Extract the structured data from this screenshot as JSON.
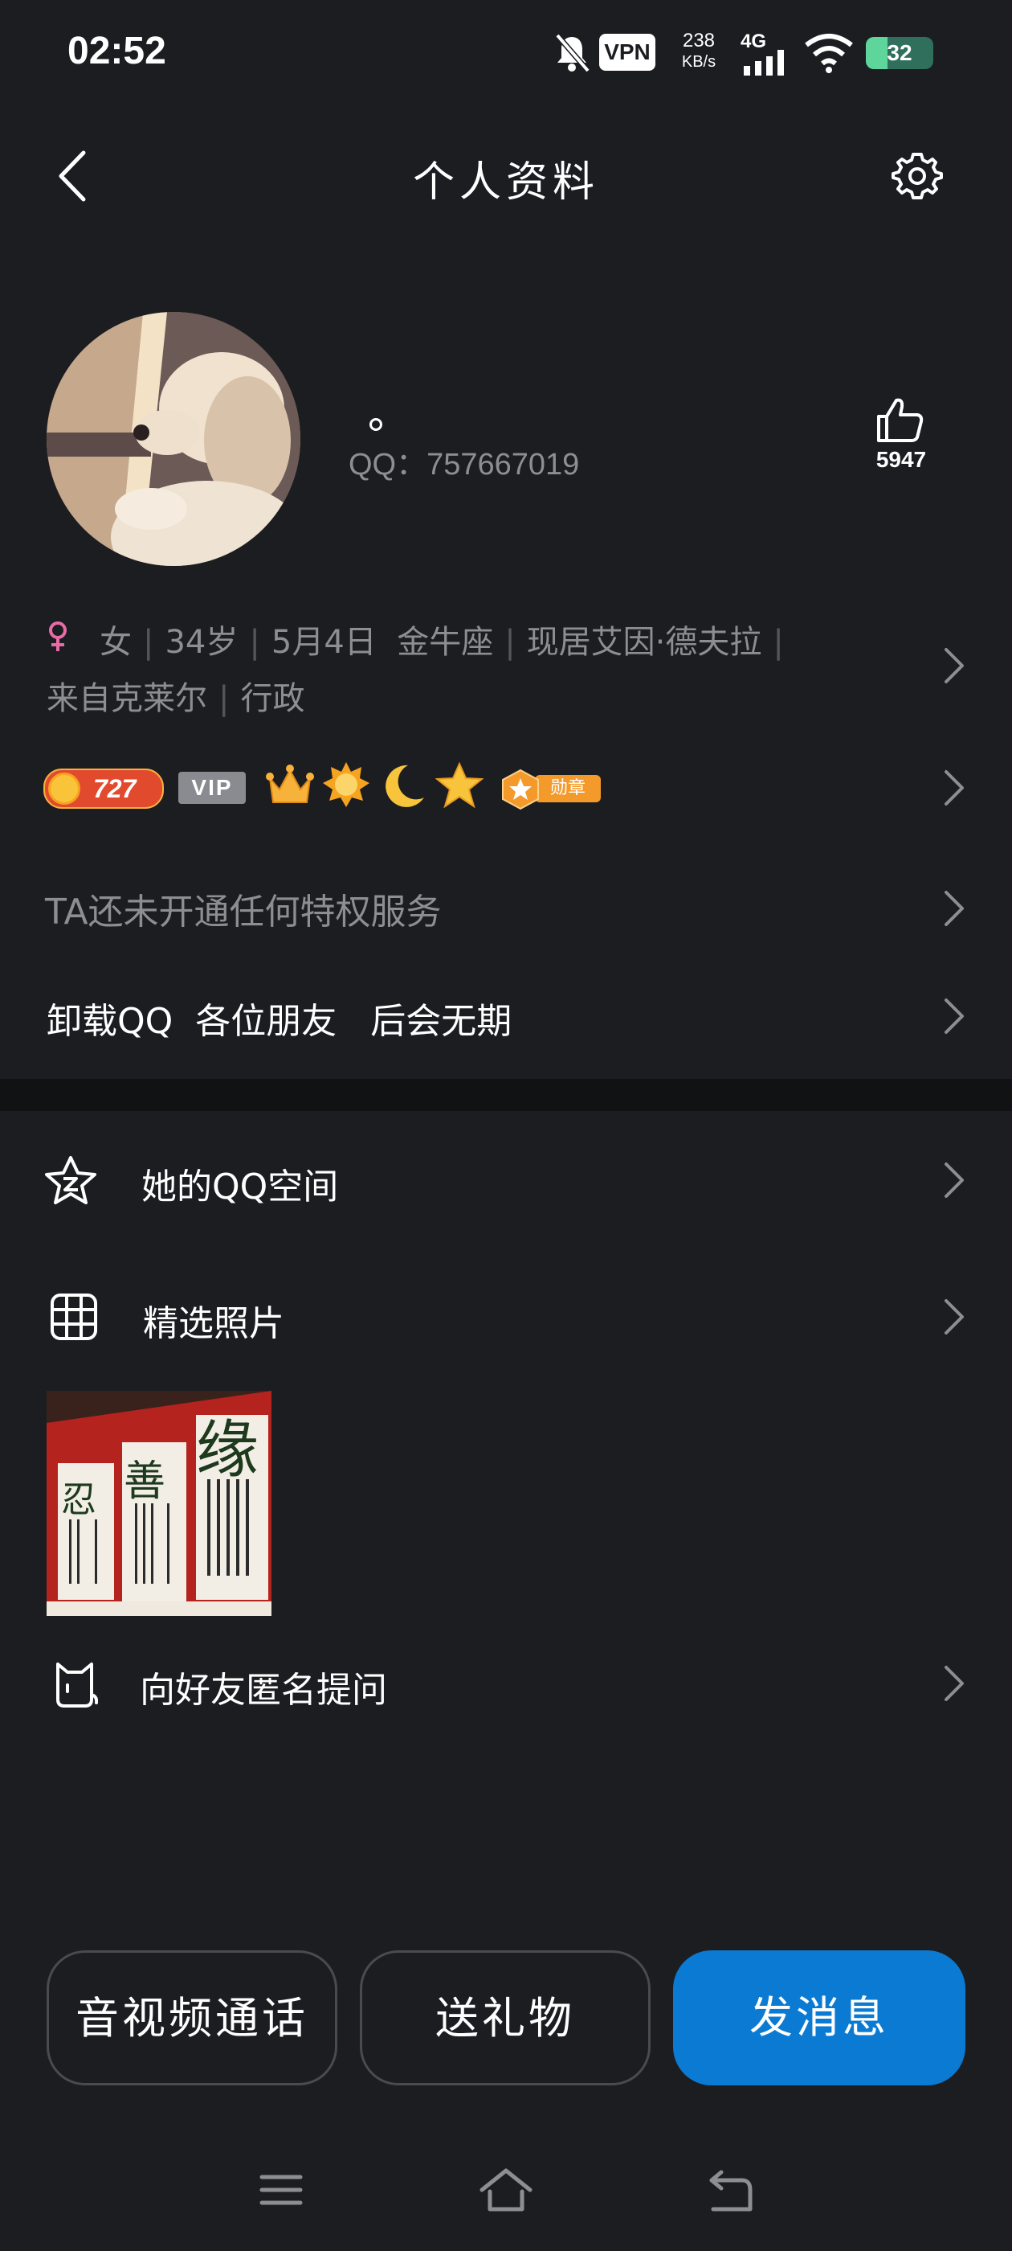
{
  "status_bar": {
    "time": "02:52",
    "vpn": "VPN",
    "speed_value": "238",
    "speed_unit": "KB/s",
    "network": "4G",
    "battery": "32",
    "battery_level": 0.32
  },
  "header": {
    "title": "个人资料"
  },
  "profile": {
    "qq_id": "QQ：757667019",
    "likes": "5947",
    "info_line1": [
      "女",
      "34岁",
      "5月4日  金牛座",
      "现居艾因·德夫拉"
    ],
    "info_line2": [
      "来自克莱尔",
      "行政"
    ],
    "coin_level": "727",
    "vip": "VIP",
    "medal_label": "勋章",
    "privilege_text": "TA还未开通任何特权服务",
    "signature": "卸载QQ  各位朋友   后会无期"
  },
  "menu": {
    "qzone": "她的QQ空间",
    "photos": "精选照片",
    "anonymous": "向好友匿名提问"
  },
  "buttons": {
    "call": "音视频通话",
    "gift": "送礼物",
    "message": "发消息"
  },
  "photo_text": {
    "big": "缘",
    "left": "忍",
    "mid": "善"
  },
  "colors": {
    "background": "#1c1d21",
    "accent": "#0a7ad2",
    "gender": "#e86aa6"
  }
}
